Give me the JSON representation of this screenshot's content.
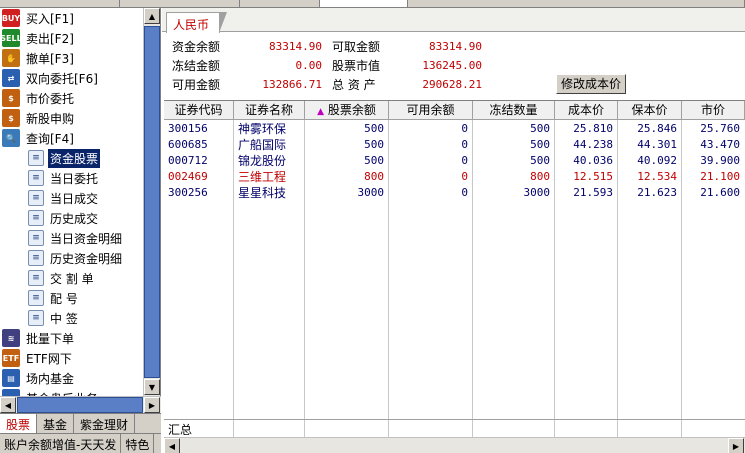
{
  "tree": {
    "items": [
      {
        "label": "买入[F1]",
        "icon": "buy-icon",
        "badge": "BUY",
        "color": "#d02020",
        "level": 0
      },
      {
        "label": "卖出[F2]",
        "icon": "sell-icon",
        "badge": "SELL",
        "color": "#1f8a2c",
        "level": 0
      },
      {
        "label": "撤单[F3]",
        "icon": "cancel-order-icon",
        "badge": "✋",
        "color": "#c07010",
        "level": 0
      },
      {
        "label": "双向委托[F6]",
        "icon": "two-way-order-icon",
        "badge": "⇄",
        "color": "#2b5fb0",
        "level": 0
      },
      {
        "label": "市价委托",
        "icon": "market-order-icon",
        "badge": "$",
        "color": "#c06010",
        "level": 0
      },
      {
        "label": "新股申购",
        "icon": "ipo-subscribe-icon",
        "badge": "$",
        "color": "#c06010",
        "level": 0
      },
      {
        "label": "查询[F4]",
        "icon": "query-magnifier-icon",
        "badge": "🔍",
        "color": "#3a7ab8",
        "level": 0
      },
      {
        "label": "资金股票",
        "icon": "document-icon",
        "level": 1,
        "selected": true
      },
      {
        "label": "当日委托",
        "icon": "document-icon",
        "level": 1
      },
      {
        "label": "当日成交",
        "icon": "document-icon",
        "level": 1
      },
      {
        "label": "历史成交",
        "icon": "document-icon",
        "level": 1
      },
      {
        "label": "当日资金明细",
        "icon": "document-icon",
        "level": 1
      },
      {
        "label": "历史资金明细",
        "icon": "document-icon",
        "level": 1
      },
      {
        "label": "交 割 单",
        "icon": "document-icon",
        "level": 1
      },
      {
        "label": "配    号",
        "icon": "document-icon",
        "level": 1
      },
      {
        "label": "中    签",
        "icon": "document-icon",
        "level": 1
      },
      {
        "label": "批量下单",
        "icon": "batch-order-icon",
        "badge": "≋",
        "color": "#404080",
        "level": 0
      },
      {
        "label": "ETF网下",
        "icon": "etf-icon",
        "badge": "ETF",
        "color": "#c06010",
        "level": 0
      },
      {
        "label": "场内基金",
        "icon": "fund-icon",
        "badge": "▤",
        "color": "#2b5fb0",
        "level": 0
      },
      {
        "label": "基金盘后业务",
        "icon": "fund-after-hours-icon",
        "badge": "▤",
        "color": "#2b5fb0",
        "level": 0
      }
    ]
  },
  "bottom_tabs": [
    {
      "label": "股票",
      "active": true
    },
    {
      "label": "基金",
      "active": false
    },
    {
      "label": "紫金理财",
      "active": false
    }
  ],
  "promo": {
    "left": "账户余额增值-天天发",
    "right": "特色"
  },
  "currency_tab": "人民币",
  "summary": {
    "fund_balance_label": "资金余额",
    "fund_balance": "83314.90",
    "withdrawable_label": "可取金额",
    "withdrawable": "83314.90",
    "frozen_label": "冻结金额",
    "frozen": "0.00",
    "stock_value_label": "股票市值",
    "stock_value": "136245.00",
    "available_label": "可用金额",
    "available": "132866.71",
    "total_assets_label": "总 资 产",
    "total_assets": "290628.21",
    "modify_cost_button": "修改成本价"
  },
  "grid": {
    "headers": [
      "证券代码",
      "证券名称",
      "股票余额",
      "可用余额",
      "冻结数量",
      "成本价",
      "保本价",
      "市价"
    ],
    "sort_marker": "▲",
    "rows": [
      {
        "code": "300156",
        "name": "神雾环保",
        "balance": "500",
        "available": "0",
        "frozen": "500",
        "cost": "25.810",
        "breakeven": "25.846",
        "price": "25.760",
        "color": "blue"
      },
      {
        "code": "600685",
        "name": "广船国际",
        "balance": "500",
        "available": "0",
        "frozen": "500",
        "cost": "44.238",
        "breakeven": "44.301",
        "price": "43.470",
        "color": "blue"
      },
      {
        "code": "000712",
        "name": "锦龙股份",
        "balance": "500",
        "available": "0",
        "frozen": "500",
        "cost": "40.036",
        "breakeven": "40.092",
        "price": "39.900",
        "color": "blue"
      },
      {
        "code": "002469",
        "name": "三维工程",
        "balance": "800",
        "available": "0",
        "frozen": "800",
        "cost": "12.515",
        "breakeven": "12.534",
        "price": "21.100",
        "color": "red"
      },
      {
        "code": "300256",
        "name": "星星科技",
        "balance": "3000",
        "available": "0",
        "frozen": "3000",
        "cost": "21.593",
        "breakeven": "21.623",
        "price": "21.600",
        "color": "blue"
      }
    ],
    "total_label": "汇总"
  }
}
